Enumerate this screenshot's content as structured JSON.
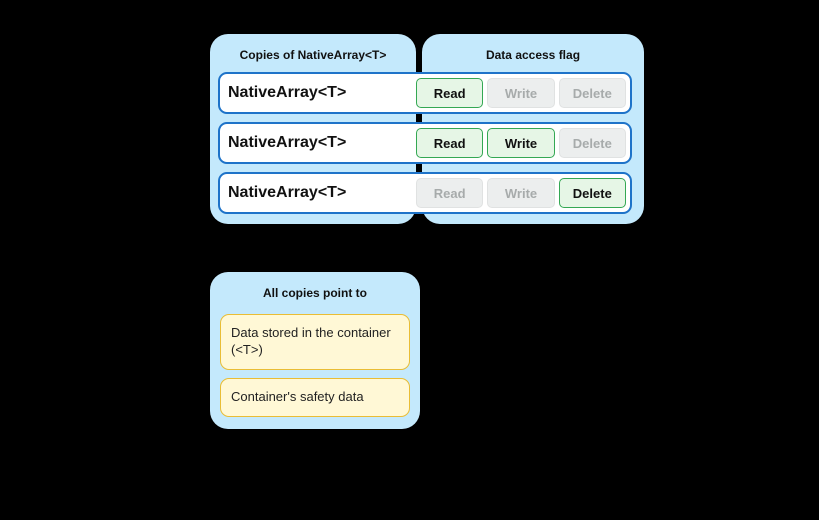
{
  "panels": {
    "copies": {
      "heading": "Copies of NativeArray<T>"
    },
    "flags": {
      "heading": "Data access flag"
    },
    "pointsTo": {
      "heading": "All copies point to"
    }
  },
  "rows": [
    {
      "label": "NativeArray<T>",
      "flags": {
        "read": true,
        "write": false,
        "delete": false
      }
    },
    {
      "label": "NativeArray<T>",
      "flags": {
        "read": true,
        "write": true,
        "delete": false
      }
    },
    {
      "label": "NativeArray<T>",
      "flags": {
        "read": false,
        "write": false,
        "delete": true
      }
    }
  ],
  "flagLabels": {
    "read": "Read",
    "write": "Write",
    "delete": "Delete"
  },
  "pointsTo": {
    "item1": "Data stored in the container (<T>)",
    "item2": "Container's safety data"
  }
}
